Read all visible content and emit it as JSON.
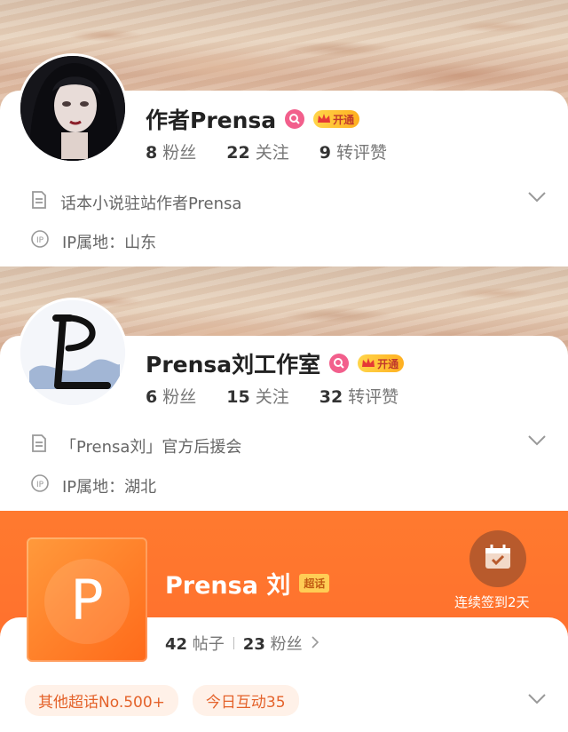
{
  "profiles": [
    {
      "name": "作者Prensa",
      "vip_label": "开通",
      "fans_count": "8",
      "fans_label": "粉丝",
      "follow_count": "22",
      "follow_label": "关注",
      "interact_count": "9",
      "interact_label": "转评赞",
      "bio": "话本小说驻站作者Prensa",
      "ip_location": "IP属地：山东"
    },
    {
      "name": "Prensa刘工作室",
      "vip_label": "开通",
      "fans_count": "6",
      "fans_label": "粉丝",
      "follow_count": "15",
      "follow_label": "关注",
      "interact_count": "32",
      "interact_label": "转评赞",
      "bio": "「Prensa刘」官方后援会",
      "ip_location": "IP属地：湖北"
    }
  ],
  "super_topic": {
    "logo_letter": "P",
    "name": "Prensa 刘",
    "tag": "超话",
    "checkin_text": "连续签到2天",
    "posts_count": "42",
    "posts_label": "帖子",
    "fans_count": "23",
    "fans_label": "粉丝",
    "chips": [
      "其他超话No.500+",
      "今日互动35"
    ]
  },
  "colors": {
    "accent_orange": "#ff6a2c",
    "text_dark": "#222222",
    "text_gray": "#777777",
    "badge_pink": "#f25f8c"
  }
}
